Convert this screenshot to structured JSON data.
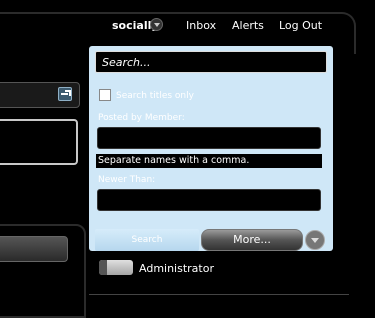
{
  "nav": {
    "socially": "socially",
    "inbox": "Inbox",
    "alerts": "Alerts",
    "logout": "Log Out"
  },
  "search": {
    "placeholder": "Search...",
    "titles_only_label": "Search titles only",
    "titles_only_checked": false,
    "posted_by_label": "Posted by Member:",
    "posted_by_value": "",
    "hint": "Separate names with a comma.",
    "newer_than_label": "Newer Than:",
    "newer_than_value": "",
    "search_button": "Search",
    "more_button": "More..."
  },
  "list": {
    "administrator": "Administrator"
  },
  "colors": {
    "panel_bg": "#cfe7f7",
    "page_bg": "#000000"
  }
}
